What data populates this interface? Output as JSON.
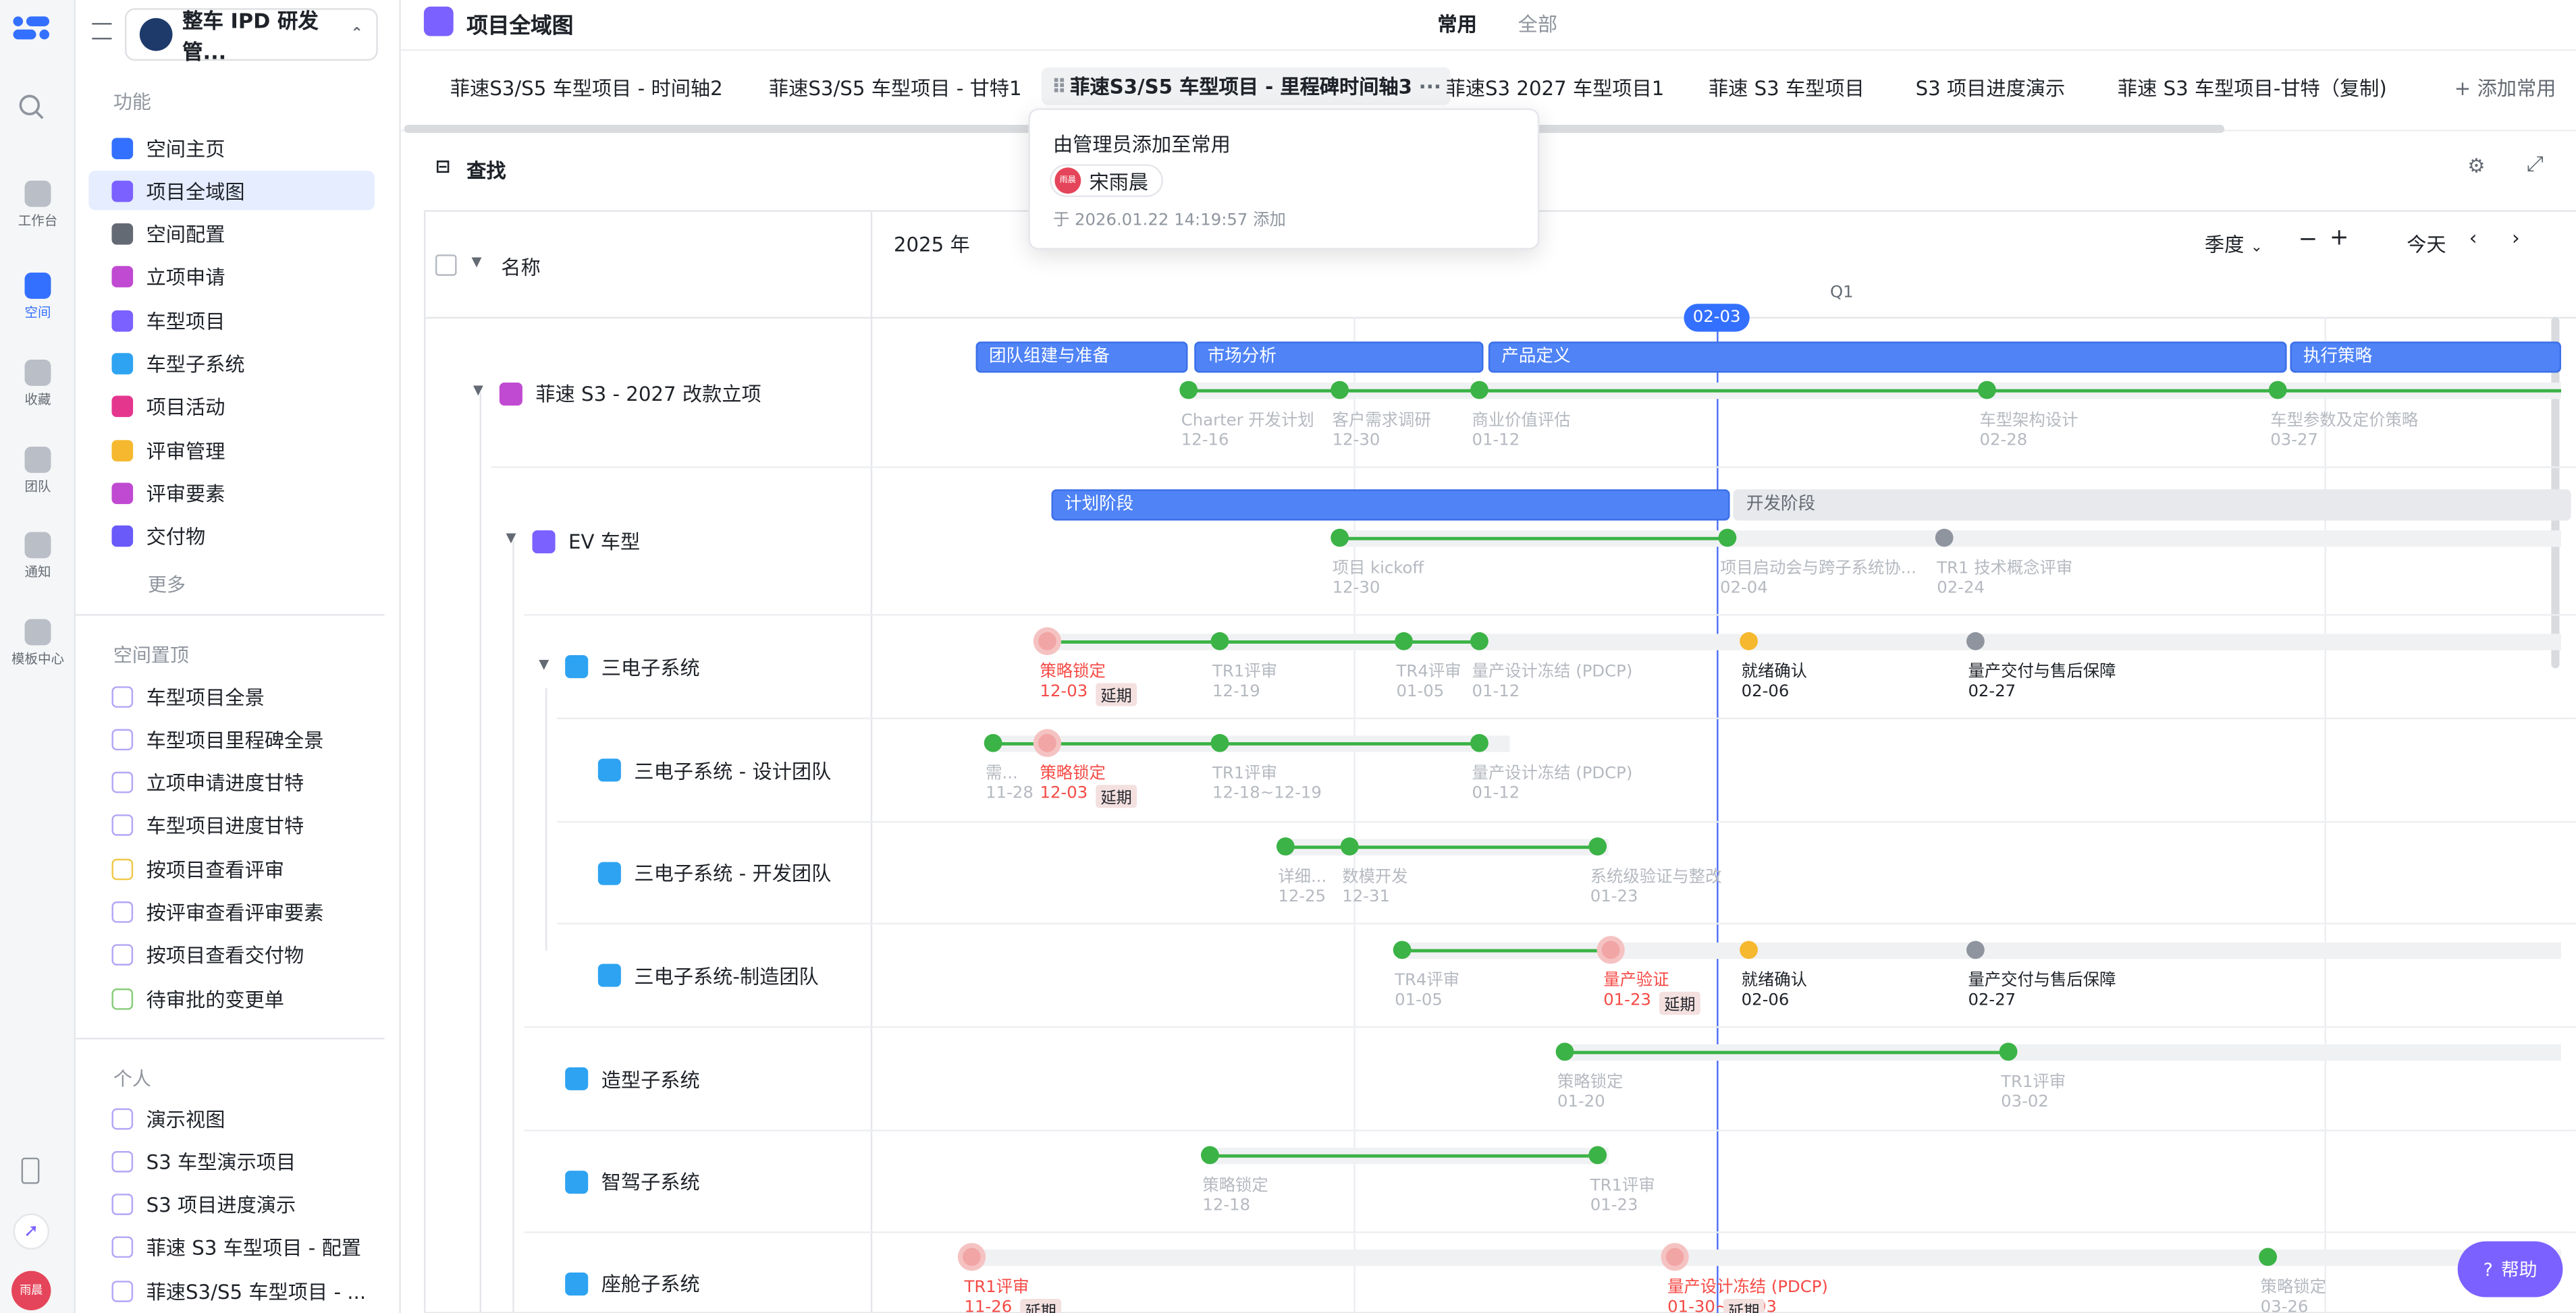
{
  "rail": {
    "items": [
      {
        "label": "工作台",
        "icon": "home-icon"
      },
      {
        "label": "空间",
        "icon": "space-icon"
      },
      {
        "label": "收藏",
        "icon": "star-icon"
      },
      {
        "label": "团队",
        "icon": "team-icon"
      },
      {
        "label": "通知",
        "icon": "bell-icon"
      },
      {
        "label": "模板中心",
        "icon": "template-icon"
      }
    ],
    "avatar": "雨晨"
  },
  "sidebar": {
    "space_name": "整车 IPD 研发管...",
    "features_title": "功能",
    "features": [
      {
        "label": "空间主页",
        "color": "#3370ff"
      },
      {
        "label": "项目全域图",
        "color": "#7b61ff"
      },
      {
        "label": "空间配置",
        "color": "#646a73"
      },
      {
        "label": "立项申请",
        "color": "#c04ad1"
      },
      {
        "label": "车型项目",
        "color": "#7b61ff"
      },
      {
        "label": "车型子系统",
        "color": "#2ea3f2"
      },
      {
        "label": "项目活动",
        "color": "#e5368e"
      },
      {
        "label": "评审管理",
        "color": "#f5b82e"
      },
      {
        "label": "评审要素",
        "color": "#c04ad1"
      },
      {
        "label": "交付物",
        "color": "#6a5af9"
      }
    ],
    "more": "更多",
    "pinned_title": "空间置顶",
    "pinned": [
      "车型项目全景",
      "车型项目里程碑全景",
      "立项申请进度甘特",
      "车型项目进度甘特",
      "按项目查看评审",
      "按评审查看评审要素",
      "按项目查看交付物",
      "待审批的变更单"
    ],
    "personal_title": "个人",
    "personal": [
      "演示视图",
      "S3 车型演示项目",
      "S3 项目进度演示",
      "菲速 S3 车型项目 - 配置",
      "菲速S3/S5 车型项目 - ..."
    ]
  },
  "header": {
    "title": "项目全域图",
    "seg_common": "常用",
    "seg_all": "全部"
  },
  "tabs": [
    "菲速S3/S5 车型项目 - 时间轴2",
    "菲速S3/S5 车型项目 - 甘特1",
    "菲速S3/S5 车型项目 - 里程碑时间轴3",
    "菲速S3 2027 车型项目1",
    "菲速 S3 车型项目",
    "S3 项目进度演示",
    "菲速 S3 车型项目-甘特（复制)"
  ],
  "add_common": "添加常用",
  "popup": {
    "title": "由管理员添加至常用",
    "user": "宋雨晨",
    "user_avatar": "雨晨",
    "time": "于 2026.01.22 14:19:57 添加"
  },
  "toolbar": {
    "search": "查找"
  },
  "grid": {
    "col_name": "名称",
    "year": "2025 年",
    "scale": "季度",
    "today": "今天",
    "quarter": "Q1",
    "today_marker": "02-03"
  },
  "rows": [
    {
      "name": "菲速 S3 - 2027 改款立项",
      "color": "#c04ad1"
    },
    {
      "name": "EV 车型",
      "color": "#7b61ff"
    },
    {
      "name": "三电子系统",
      "color": "#2ea3f2"
    },
    {
      "name": "三电子系统 - 设计团队",
      "color": "#2ea3f2"
    },
    {
      "name": "三电子系统 - 开发团队",
      "color": "#2ea3f2"
    },
    {
      "name": "三电子系统-制造团队",
      "color": "#2ea3f2"
    },
    {
      "name": "造型子系统",
      "color": "#2ea3f2"
    },
    {
      "name": "智驾子系统",
      "color": "#2ea3f2"
    },
    {
      "name": "座舱子系统",
      "color": "#2ea3f2"
    }
  ],
  "phases": [
    "团队组建与准备",
    "市场分析",
    "产品定义",
    "执行策略",
    "计划阶段",
    "开发阶段"
  ],
  "milestones": {
    "r1": [
      {
        "name": "Charter 开发计划",
        "date": "12-16"
      },
      {
        "name": "客户需求调研",
        "date": "12-30"
      },
      {
        "name": "商业价值评估",
        "date": "01-12"
      },
      {
        "name": "车型架构设计",
        "date": "02-28"
      },
      {
        "name": "车型参数及定价策略",
        "date": "03-27"
      }
    ],
    "r2": [
      {
        "name": "项目 kickoff",
        "date": "12-30"
      },
      {
        "name": "项目启动会与跨子系统协...",
        "date": "02-04"
      },
      {
        "name": "TR1 技术概念评审",
        "date": "02-24"
      }
    ],
    "r3": [
      {
        "name": "策略锁定",
        "date": "12-03"
      },
      {
        "name": "TR1评审",
        "date": "12-19"
      },
      {
        "name": "TR4评审",
        "date": "01-05"
      },
      {
        "name": "量产设计冻结 (PDCP)",
        "date": "01-12"
      },
      {
        "name": "就绪确认",
        "date": "02-06"
      },
      {
        "name": "量产交付与售后保障",
        "date": "02-27"
      }
    ],
    "r4": [
      {
        "name": "需...",
        "date": "11-28"
      },
      {
        "name": "策略锁定",
        "date": "12-03"
      },
      {
        "name": "TR1评审",
        "date": "12-18~12-19"
      },
      {
        "name": "量产设计冻结 (PDCP)",
        "date": "01-12"
      }
    ],
    "r5": [
      {
        "name": "详细...",
        "date": "12-25"
      },
      {
        "name": "数模开发",
        "date": "12-31"
      },
      {
        "name": "系统级验证与整改",
        "date": "01-23"
      }
    ],
    "r6": [
      {
        "name": "TR4评审",
        "date": "01-05"
      },
      {
        "name": "量产验证",
        "date": "01-23"
      },
      {
        "name": "就绪确认",
        "date": "02-06"
      },
      {
        "name": "量产交付与售后保障",
        "date": "02-27"
      }
    ],
    "r7": [
      {
        "name": "策略锁定",
        "date": "01-20"
      },
      {
        "name": "TR1评审",
        "date": "03-02"
      }
    ],
    "r8": [
      {
        "name": "策略锁定",
        "date": "12-18"
      },
      {
        "name": "TR1评审",
        "date": "01-23"
      }
    ],
    "r9": [
      {
        "name": "TR1评审",
        "date": "11-26"
      },
      {
        "name": "量产设计冻结 (PDCP)",
        "date": "01-30~02-03"
      },
      {
        "name": "策略锁定",
        "date": "03-26"
      }
    ]
  },
  "late_tag": "延期",
  "help": "帮助"
}
